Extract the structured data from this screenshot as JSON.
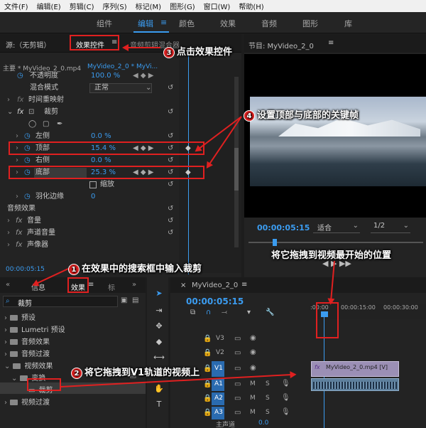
{
  "menu": [
    "文件(F)",
    "编辑(E)",
    "剪辑(C)",
    "序列(S)",
    "标记(M)",
    "图形(G)",
    "窗口(W)",
    "帮助(H)"
  ],
  "workspaces": [
    "组件",
    "编辑",
    "颜色",
    "效果",
    "音频",
    "图形",
    "库"
  ],
  "effect_controls": {
    "source_label": "源:（无剪辑）",
    "tab_label": "效果控件",
    "mixer_tab": "音频剪辑混合器",
    "master": "主要 * MyVideo_2_0.mp4",
    "sequence": "MyVideo_2_0 * MyVi...",
    "rows": [
      {
        "name": "不透明度",
        "value": "100.0 %"
      },
      {
        "name": "混合模式",
        "value": "正常"
      },
      {
        "name": "时间重映射",
        "value": ""
      },
      {
        "name": "裁剪",
        "value": ""
      },
      {
        "name": "左侧",
        "value": "0.0 %"
      },
      {
        "name": "顶部",
        "value": "15.4 %"
      },
      {
        "name": "右侧",
        "value": "0.0 %"
      },
      {
        "name": "底部",
        "value": "25.3 %"
      },
      {
        "name": "缩放",
        "value": ""
      },
      {
        "name": "羽化边缘",
        "value": "0"
      }
    ],
    "audio_header": "音频效果",
    "audio_rows": [
      "音量",
      "声道音量",
      "声像器"
    ],
    "timecode": "00:00:05:15"
  },
  "program": {
    "title": "节目: MyVideo_2_0",
    "timecode": "00:00:05:15",
    "fit": "适合",
    "quality": "1/2"
  },
  "effects_panel": {
    "tabs": [
      "信息",
      "效果",
      "标"
    ],
    "search_value": "裁剪",
    "tree": [
      {
        "label": "预设",
        "indent": 0
      },
      {
        "label": "Lumetri 预设",
        "indent": 0
      },
      {
        "label": "音频效果",
        "indent": 0
      },
      {
        "label": "音频过渡",
        "indent": 0
      },
      {
        "label": "视频效果",
        "indent": 0
      },
      {
        "label": "变换",
        "indent": 1
      },
      {
        "label": "裁剪",
        "indent": 2
      },
      {
        "label": "视频过渡",
        "indent": 0
      }
    ]
  },
  "timeline": {
    "title": "MyVideo_2_0",
    "timecode": "00:00:05:15",
    "ruler": [
      ":00:00",
      "00:00:15:00",
      "00:00:30:00"
    ],
    "tracks": [
      "V3",
      "V2",
      "V1",
      "A1",
      "A2",
      "A3"
    ],
    "master": "主声道",
    "master_value": "0.0",
    "clip_label": "MyVideo_2_0.mp4 [V]"
  },
  "annotations": {
    "a1": "在效果中的搜索框中输入裁剪",
    "a2": "将它拖拽到V1轨道的视频上",
    "a3": "点击效果控件",
    "a4": "设置顶部与底部的关键帧",
    "a5": "将它拖拽到视频最开始的位置",
    "n1": "1",
    "n2": "2",
    "n3": "3",
    "n4": "4"
  }
}
